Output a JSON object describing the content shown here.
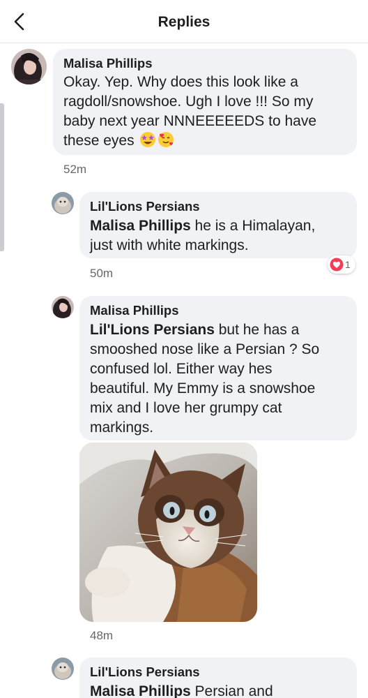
{
  "header": {
    "title": "Replies",
    "back_icon": "chevron-left-icon"
  },
  "comments": [
    {
      "author": "Malisa Phillips",
      "lines": [
        "Okay. Yep. Why does this look like a",
        "ragdoll/snowshoe. Ugh I love !!! So my",
        "baby next year NNNEEEEEDS to have",
        "these eyes"
      ],
      "emojis": [
        "star-struck-icon",
        "smiling-hearts-icon"
      ],
      "time": "52m"
    },
    {
      "author": "Lil'Lions Persians",
      "mention": "Malisa Phillips",
      "line1_rest": " he is a Himalayan,",
      "line2": "just with white markings.",
      "time": "50m",
      "reaction": {
        "icon": "heart-icon",
        "count": "1",
        "color": "#f33e58"
      }
    },
    {
      "author": "Malisa Phillips",
      "mention": "Lil'Lions Persians",
      "line1_rest": " but he has a",
      "lines": [
        "smooshed nose like a Persian ? So",
        "confused lol. Either way hes",
        "beautiful. My Emmy is a snowshoe",
        "mix and I love her grumpy cat",
        "markings."
      ],
      "photo": "cat-photo",
      "time": "48m"
    },
    {
      "author": "Lil'Lions Persians",
      "mention": "Malisa Phillips",
      "partial_rest": " Persian and"
    }
  ]
}
